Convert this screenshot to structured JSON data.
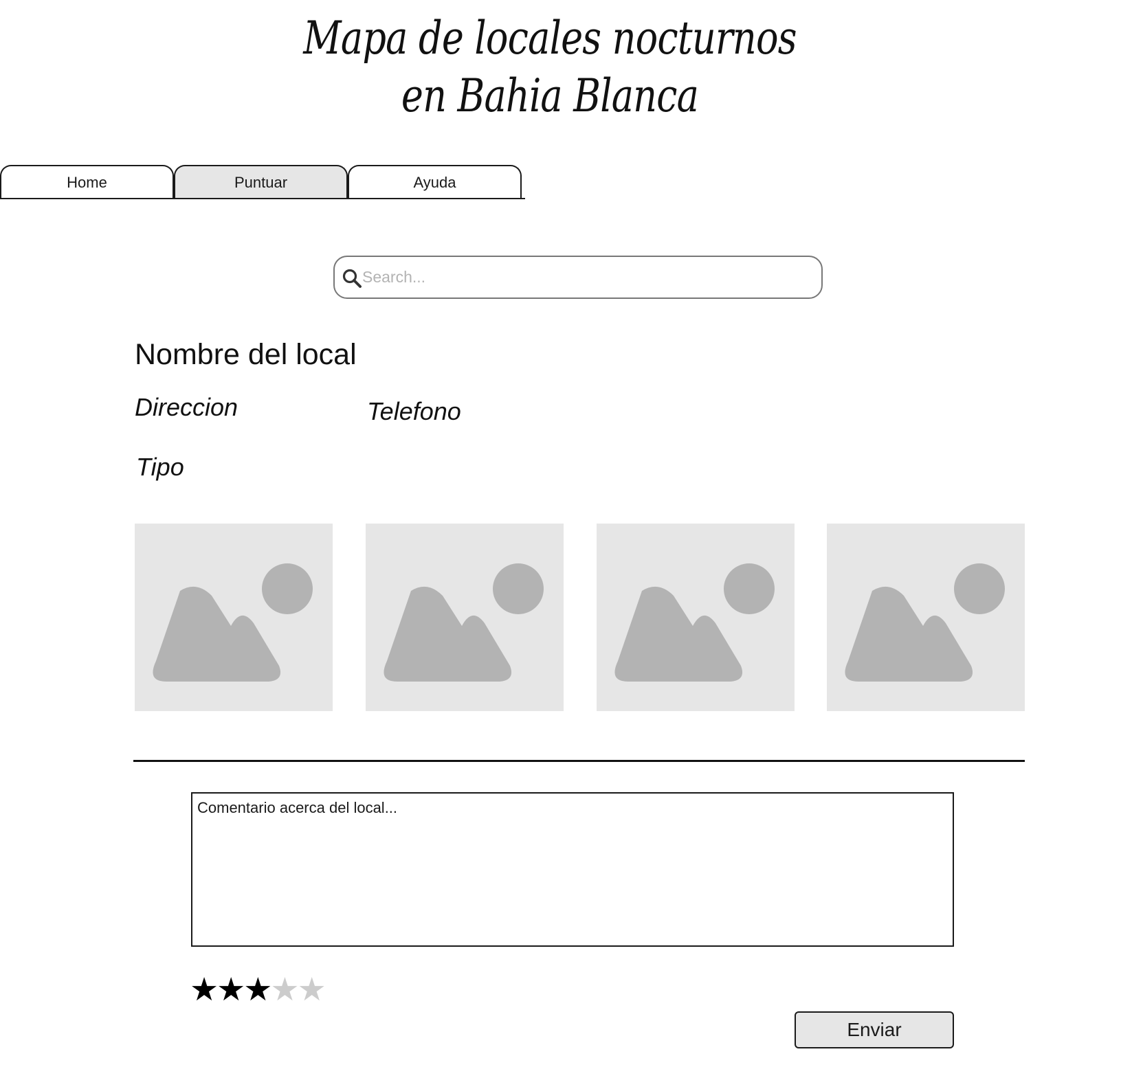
{
  "header": {
    "title_line1": "Mapa de locales nocturnos",
    "title_line2": "en Bahia Blanca"
  },
  "nav": {
    "tabs": [
      {
        "label": "Home",
        "active": false
      },
      {
        "label": "Puntuar",
        "active": true
      },
      {
        "label": "Ayuda",
        "active": false
      }
    ]
  },
  "search": {
    "placeholder": "Search...",
    "value": "",
    "icon": "search-icon"
  },
  "venue": {
    "name": "Nombre del local",
    "address_label": "Direccion",
    "phone_label": "Telefono",
    "type_label": "Tipo",
    "image_icon": "image-placeholder-icon",
    "image_count": 4
  },
  "review": {
    "comment_placeholder": "Comentario acerca del local...",
    "comment_value": "",
    "rating": 3,
    "rating_max": 5,
    "submit_label": "Enviar"
  },
  "colors": {
    "active_tab": "#e6e6e6",
    "image_bg": "#e6e6e6",
    "image_fg": "#b3b3b3",
    "star_on": "#000000",
    "star_off": "#cccccc"
  }
}
